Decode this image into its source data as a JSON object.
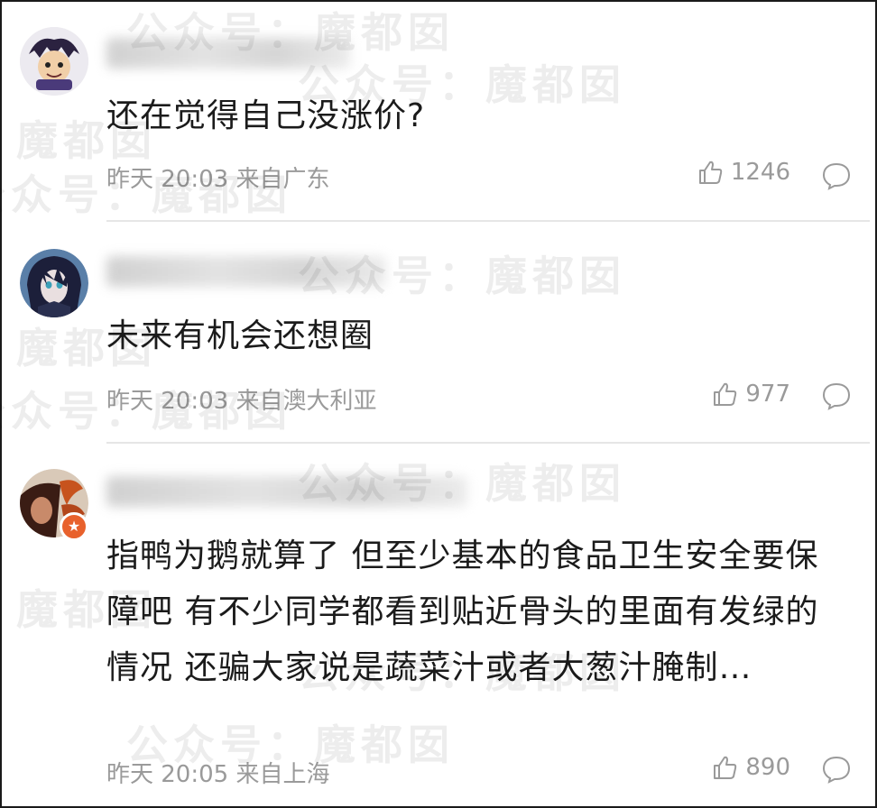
{
  "comments": [
    {
      "text": "还在觉得自己没涨价?",
      "time": "昨天 20:03",
      "location": "来自广东",
      "likes": "1246"
    },
    {
      "text": "未来有机会还想圈",
      "time": "昨天 20:03",
      "location": "来自澳大利亚",
      "likes": "977"
    },
    {
      "text": "指鸭为鹅就算了 但至少基本的食品卫生安全要保障吧 有不少同学都看到贴近骨头的里面有发绿的情况 还骗大家说是蔬菜汁或者大葱汁腌制…",
      "time": "昨天 20:05",
      "location": "来自上海",
      "likes": "890"
    }
  ],
  "watermark": "公众号：魔都囡",
  "icons": {
    "like": "thumbs-up-icon",
    "reply": "speech-bubble-icon",
    "badge": "star-badge-icon"
  },
  "colors": {
    "meta_text": "#9a9a9a",
    "badge": "#e8612c",
    "divider": "#e6e6e6"
  }
}
